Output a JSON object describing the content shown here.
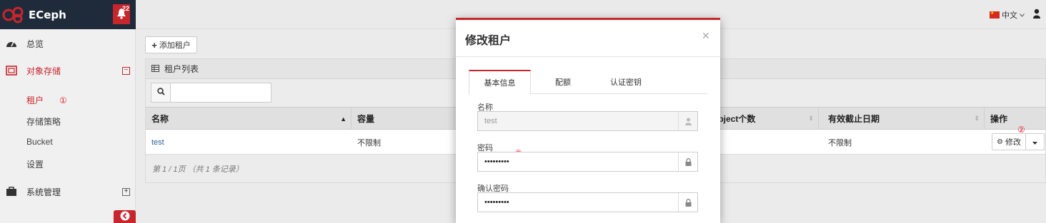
{
  "app": {
    "title": "ECeph",
    "alert_count": "22"
  },
  "header": {
    "language": "中文"
  },
  "sidebar": {
    "items": [
      {
        "label": "总览",
        "icon": "dashboard-icon"
      },
      {
        "label": "对象存储",
        "icon": "object-storage-icon",
        "expanded": true
      },
      {
        "label": "系统管理",
        "icon": "briefcase-icon",
        "expanded": false
      }
    ],
    "sub_items": [
      "租户",
      "存储策略",
      "Bucket",
      "设置"
    ]
  },
  "main": {
    "add_button": "添加租户",
    "panel_title": "租户列表",
    "columns": [
      "名称",
      "容量",
      "Object个数",
      "有效截止日期",
      "操作"
    ],
    "rows": [
      {
        "name": "test",
        "capacity": "不限制",
        "expiry": "不限制",
        "action": "修改"
      }
    ],
    "pager": "第 1 / 1页 （共 1 条记录）"
  },
  "markers": [
    "①",
    "②",
    "③"
  ],
  "modal": {
    "title": "修改租户",
    "tabs": [
      "基本信息",
      "配额",
      "认证密钥"
    ],
    "fields": {
      "name_label": "名称",
      "name_value": "test",
      "password_label": "密码",
      "password_value": "•••••••••",
      "confirm_label": "确认密码",
      "confirm_value": "•••••••••"
    }
  },
  "colors": {
    "accent": "#c7262c",
    "brand_bg": "#1f2b3a",
    "link": "#2a6496"
  }
}
